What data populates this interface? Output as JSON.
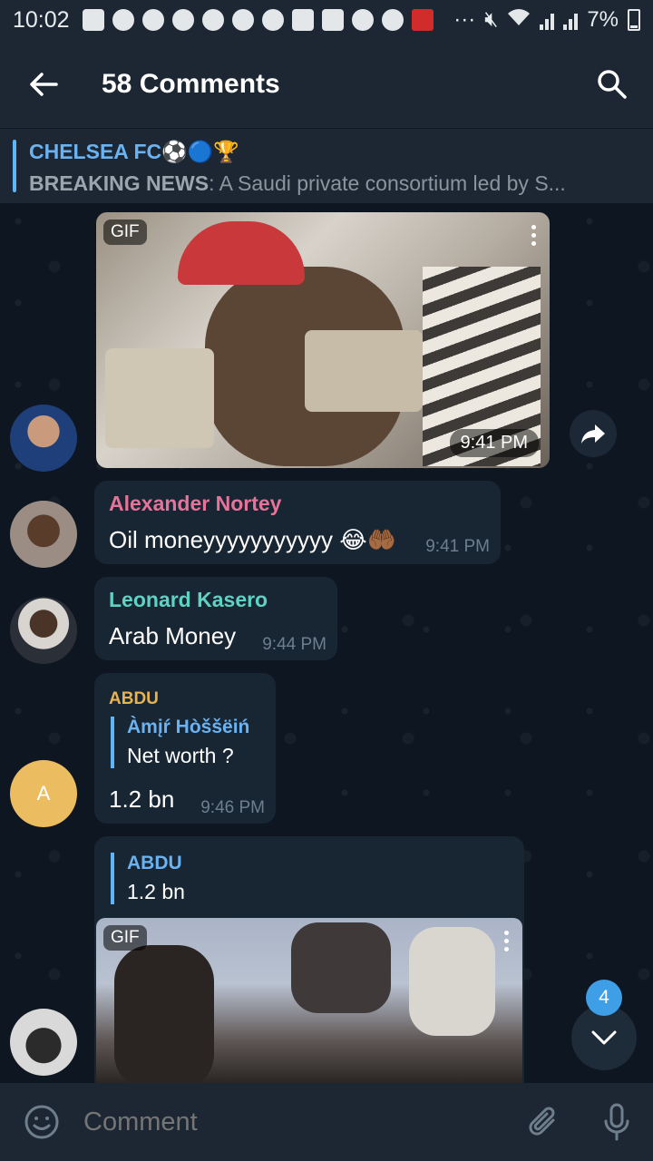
{
  "status_bar": {
    "time": "10:02",
    "battery": "7%"
  },
  "header": {
    "title": "58 Comments"
  },
  "pinned": {
    "channel": "CHELSEA FC⚽🔵🏆",
    "preview_bold": "BREAKING NEWS",
    "preview_rest": ": A Saudi private consortium led by S..."
  },
  "messages": [
    {
      "type": "gif",
      "badge": "GIF",
      "time": "9:41 PM"
    },
    {
      "sender": "Alexander Nortey",
      "text": "Oil moneyyyyyyyyyyy 😂🤲🏾",
      "time": "9:41 PM",
      "color": "#e67399"
    },
    {
      "sender": "Leonard Kasero",
      "text": "Arab Money",
      "time": "9:44 PM",
      "color": "#5fd3c3"
    },
    {
      "sender": "ABDU",
      "color": "#e8b34f",
      "reply_name": "Àmįŕ Hòššëiń",
      "reply_text": "Net worth ?",
      "text": "1.2 bn",
      "time": "9:46 PM",
      "avatar_letter": "A"
    },
    {
      "type": "gif-reply",
      "reply_name": "ABDU",
      "reply_text": "1.2 bn",
      "badge": "GIF"
    }
  ],
  "unread_count": "4",
  "composer": {
    "placeholder": "Comment"
  },
  "colors": {
    "background": "#0e1621",
    "bar": "#1c2733",
    "bubble": "#182533",
    "accent": "#5eb5f7"
  }
}
